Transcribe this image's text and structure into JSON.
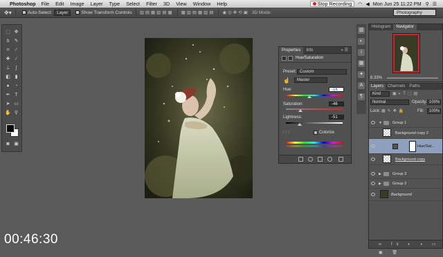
{
  "menubar": {
    "app_name": "Photoshop",
    "items": [
      "File",
      "Edit",
      "Image",
      "Layer",
      "Type",
      "Select",
      "Filter",
      "3D",
      "View",
      "Window",
      "Help"
    ],
    "recording_label": "Stop Recording",
    "clock": "Mon Jun 25  11:22 PM"
  },
  "options_bar": {
    "auto_select_label": "Auto-Select:",
    "auto_select_value": "Layer",
    "transform_label": "Show Transform Controls",
    "mode_label": "3D Mode:",
    "workspace": "Photography"
  },
  "properties": {
    "tabs": [
      "Properties",
      "Info"
    ],
    "title": "Hue/Saturation",
    "preset_label": "Preset:",
    "preset_value": "Custom",
    "channel_value": "Master",
    "hue_label": "Hue:",
    "hue_value": "-16",
    "saturation_label": "Saturation:",
    "saturation_value": "-46",
    "lightness_label": "Lightness:",
    "lightness_value": "-51",
    "colorize_label": "Colorize"
  },
  "navigator": {
    "tabs": [
      "Histogram",
      "Navigator"
    ],
    "zoom": "8.33%"
  },
  "layers": {
    "tabs": [
      "Layers",
      "Channels",
      "Paths"
    ],
    "filter_value": "Kind",
    "blend_mode": "Normal",
    "opacity_label": "Opacity:",
    "opacity_value": "100%",
    "lock_label": "Lock:",
    "fill_label": "Fill:",
    "fill_value": "100%",
    "items": [
      {
        "name": "Group 1"
      },
      {
        "name": "Background copy 2"
      },
      {
        "name": "Hue/Sat..."
      },
      {
        "name": "Background copy"
      },
      {
        "name": "Group 3"
      },
      {
        "name": "Group 2"
      },
      {
        "name": "Background"
      }
    ]
  },
  "timer": "00:46:30"
}
